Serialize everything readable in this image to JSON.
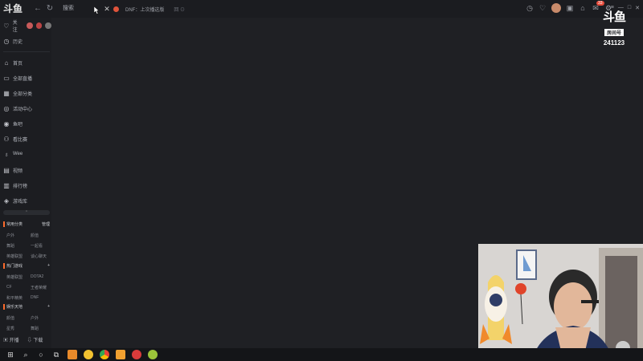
{
  "app": {
    "logo": "斗鱼"
  },
  "topbar": {
    "search_value": "搜索",
    "tab_title": "DNF：上次播这版",
    "tab_extra": "回 ⊙"
  },
  "notifications": {
    "count": "33"
  },
  "sidebar": {
    "follow_label": "关注",
    "history_label": "历史",
    "items": [
      {
        "label": "首页",
        "icon": "home-icon"
      },
      {
        "label": "全部直播",
        "icon": "tv-icon"
      },
      {
        "label": "全部分类",
        "icon": "grid-icon"
      },
      {
        "label": "活动中心",
        "icon": "target-icon"
      },
      {
        "label": "鱼吧",
        "icon": "fish-icon"
      },
      {
        "label": "看比赛",
        "icon": "trophy-icon"
      },
      {
        "label": "Wee",
        "icon": "pin-icon"
      },
      {
        "label": "视频",
        "icon": "video-icon"
      },
      {
        "label": "排行榜",
        "icon": "rank-icon"
      },
      {
        "label": "游戏库",
        "icon": "gamepad-icon"
      }
    ],
    "sections": [
      {
        "title": "常用分类",
        "action": "管理",
        "cats": [
          "户外",
          "颜值",
          "舞蹈",
          "一起看",
          "英雄联盟",
          "谈心聊天"
        ]
      },
      {
        "title": "热门游戏",
        "action": "+",
        "cats": [
          "英雄联盟",
          "DOTA2",
          "CF",
          "王者荣耀",
          "和平精英",
          "DNF"
        ]
      },
      {
        "title": "娱乐天地",
        "action": "+",
        "cats": [
          "颜值",
          "户外",
          "星秀",
          "舞蹈"
        ]
      }
    ],
    "bottom": {
      "open_live": "开播",
      "download": "下载"
    }
  },
  "watermark": {
    "logo": "斗鱼",
    "label": "房间号",
    "room_id": "241123"
  },
  "colors": {
    "accent": "#ff6a2b",
    "bg": "#1f2024",
    "sidebar": "#1c1d21"
  }
}
